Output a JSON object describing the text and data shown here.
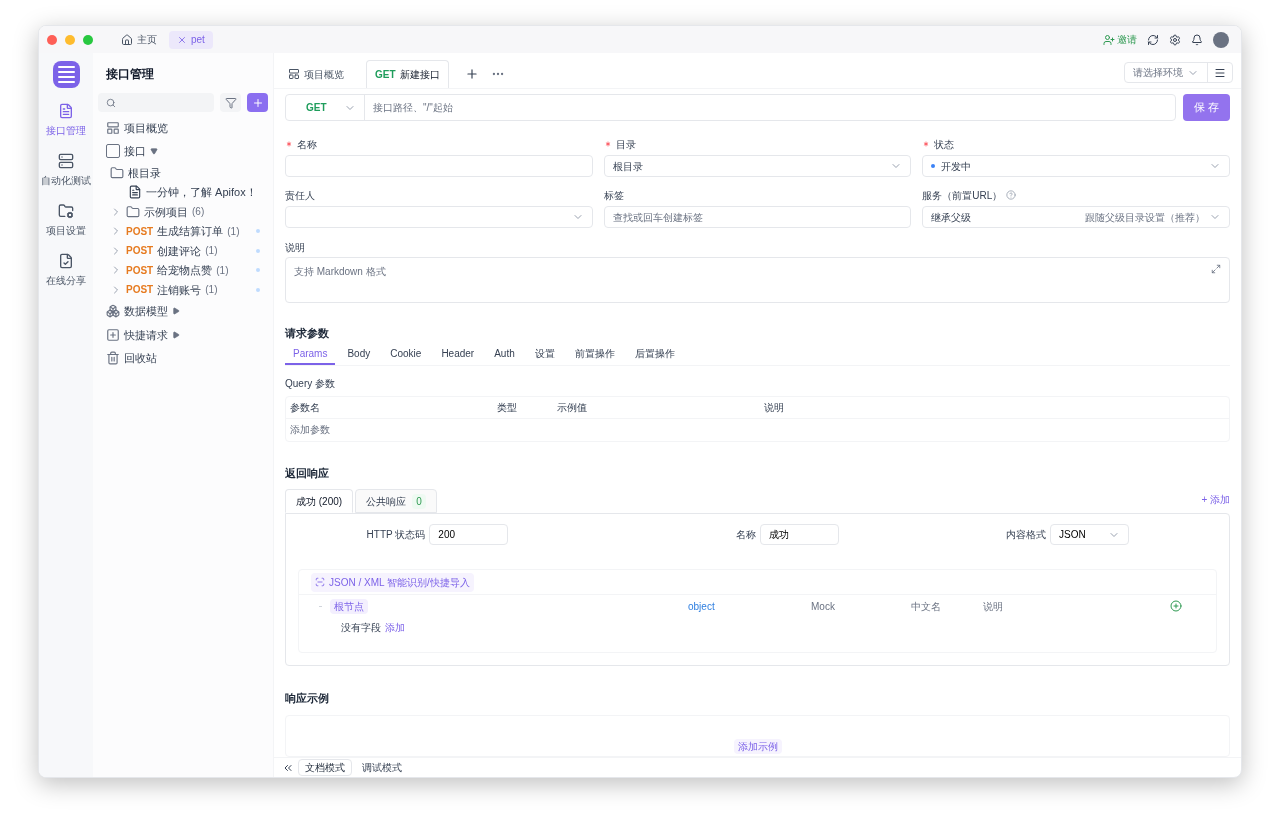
{
  "titlebar": {
    "tabs": [
      {
        "kind": "home",
        "label": "主页",
        "selected": false
      },
      {
        "kind": "project",
        "label": "pet",
        "selected": true
      }
    ],
    "invite": "邀请"
  },
  "rail": [
    {
      "kind": "api",
      "label": "接口管理",
      "selected": true
    },
    {
      "kind": "test",
      "label": "自动化测试",
      "selected": false
    },
    {
      "kind": "settings",
      "label": "项目设置",
      "selected": false
    },
    {
      "kind": "share",
      "label": "在线分享",
      "selected": false
    }
  ],
  "sidebar": {
    "title": "接口管理",
    "tree": [
      {
        "kind": "overview",
        "label": "项目概览"
      },
      {
        "kind": "apis",
        "label": "接口",
        "expanded": true,
        "children": [
          {
            "kind": "folder",
            "label": "根目录",
            "children": [
              {
                "kind": "doc",
                "label": "一分钟，了解 Apifox！"
              }
            ]
          },
          {
            "kind": "folder",
            "label": "示例项目",
            "count": "(6)",
            "expanded": false
          },
          {
            "kind": "endpoint",
            "method": "POST",
            "label": "生成结算订单",
            "count": "(1)",
            "expanded": false
          },
          {
            "kind": "endpoint",
            "method": "POST",
            "label": "创建评论",
            "count": "(1)",
            "expanded": false
          },
          {
            "kind": "endpoint",
            "method": "POST",
            "label": "给宠物点赞",
            "count": "(1)",
            "expanded": false
          },
          {
            "kind": "endpoint",
            "method": "POST",
            "label": "注销账号",
            "count": "(1)",
            "expanded": false
          }
        ]
      },
      {
        "kind": "models",
        "label": "数据模型",
        "expanded": false
      },
      {
        "kind": "quick",
        "label": "快捷请求",
        "expanded": false
      },
      {
        "kind": "trash",
        "label": "回收站"
      }
    ]
  },
  "tabs": [
    {
      "kind": "overview",
      "label": "项目概览",
      "selected": false
    },
    {
      "kind": "endpoint",
      "method": "GET",
      "label": "新建接口",
      "selected": true
    }
  ],
  "env_select": {
    "placeholder": "请选择环境"
  },
  "url_bar": {
    "method": "GET",
    "placeholder": "接口路径、\"/\"起始",
    "save": "保 存"
  },
  "fields": [
    {
      "kind": "input",
      "label": "名称",
      "required": true
    },
    {
      "kind": "select",
      "label": "目录",
      "required": true,
      "value": "根目录"
    },
    {
      "kind": "status",
      "label": "状态",
      "required": true,
      "value": "开发中",
      "color": "#3b82f6"
    },
    {
      "kind": "select",
      "label": "责任人",
      "required": false
    },
    {
      "kind": "tags",
      "label": "标签",
      "required": false,
      "placeholder": "查找或回车创建标签"
    },
    {
      "kind": "service",
      "label": "服务（前置URL）",
      "required": false,
      "value": "继承父级",
      "hint": "跟随父级目录设置（推荐）"
    }
  ],
  "description": {
    "label": "说明",
    "placeholder": "支持 Markdown 格式"
  },
  "request": {
    "title": "请求参数",
    "tabs": [
      {
        "label": "Params",
        "selected": true
      },
      {
        "label": "Body",
        "selected": false
      },
      {
        "label": "Cookie",
        "selected": false
      },
      {
        "label": "Header",
        "selected": false
      },
      {
        "label": "Auth",
        "selected": false
      },
      {
        "label": "设置",
        "selected": false
      },
      {
        "label": "前置操作",
        "selected": false
      },
      {
        "label": "后置操作",
        "selected": false
      }
    ],
    "query_title": "Query 参数",
    "columns": [
      "参数名",
      "类型",
      "示例值",
      "说明"
    ],
    "add_row_hint": "添加参数"
  },
  "response": {
    "title": "返回响应",
    "tabs": [
      {
        "label": "成功 (200)",
        "selected": true
      },
      {
        "label": "公共响应",
        "badge": "0",
        "selected": false
      }
    ],
    "add": "+ 添加",
    "status_label": "HTTP 状态码",
    "status_value": "200",
    "name_label": "名称",
    "name_value": "成功",
    "format_label": "内容格式",
    "format_value": "JSON",
    "import": "JSON / XML 智能识别/快捷导入",
    "root": "根节点",
    "type": "object",
    "mock_placeholder": "Mock",
    "cn_name_placeholder": "中文名",
    "desc_placeholder": "说明",
    "empty": "没有字段",
    "empty_add": "添加"
  },
  "example": {
    "title": "响应示例",
    "add": "添加示例"
  },
  "bottom": [
    {
      "label": "文档模式",
      "selected": true
    },
    {
      "label": "调试模式",
      "selected": false
    }
  ]
}
